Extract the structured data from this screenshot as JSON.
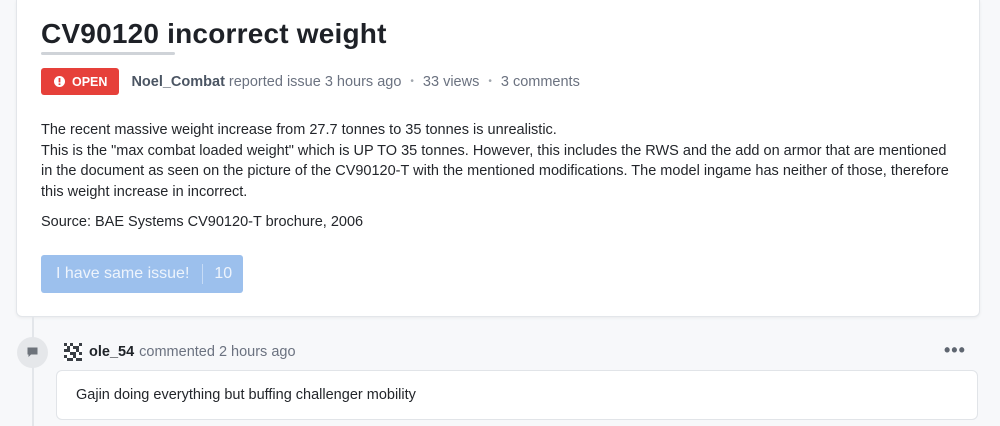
{
  "issue": {
    "title": "CV90120 incorrect weight",
    "status": "OPEN",
    "author": "Noel_Combat",
    "reported_text": "reported issue 3 hours ago",
    "views": "33 views",
    "comments": "3 comments",
    "body": [
      "The recent massive weight increase from 27.7 tonnes to 35 tonnes is unrealistic.",
      "This is the \"max combat loaded weight\" which is UP TO 35 tonnes. However, this includes the RWS and the add on armor that are mentioned in the document as seen on the picture of the CV90120-T with the mentioned modifications. The model ingame has neither of those, therefore this weight increase in incorrect."
    ],
    "source": "Source: BAE Systems CV90120-T brochure, 2006",
    "same_issue_label": "I have same issue!",
    "same_issue_count": "10"
  },
  "comment": {
    "author": "ole_54",
    "meta": "commented 2 hours ago",
    "text": "Gajin doing everything but buffing challenger mobility"
  },
  "colors": {
    "status_open": "#e6403a",
    "button_disabled": "#9cc0ed"
  },
  "icons": {
    "status": "bug-icon",
    "comment": "speech-bubble-icon",
    "menu": "more-dots-icon"
  }
}
